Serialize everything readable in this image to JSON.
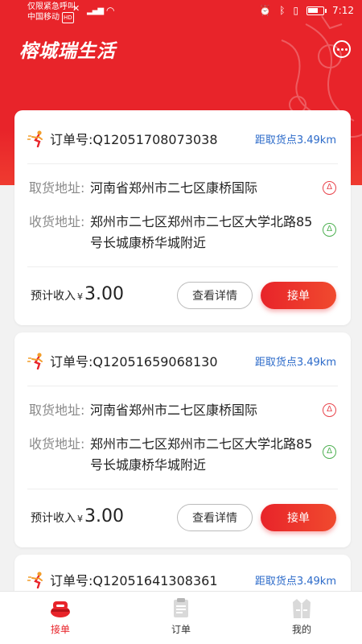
{
  "status_bar": {
    "carrier_line1": "仅限紧急呼叫",
    "carrier_line2": "中国移动",
    "hd_badge": "HD",
    "time": "7:12"
  },
  "header": {
    "brand": "榕城瑞生活",
    "chat_icon": "chat-bubble-icon"
  },
  "colors": {
    "brand_red": "#e8242a",
    "link_blue": "#2b6ac9",
    "pickup_badge": "#e8424a",
    "dropoff_badge": "#4caf50"
  },
  "orders": [
    {
      "order_label": "订单号:Q12051708073038",
      "distance": "距取货点3.49km",
      "pickup_label": "取货地址:",
      "pickup_address": "河南省郑州市二七区康桥国际",
      "dropoff_label": "收货地址:",
      "dropoff_address": "郑州市二七区郑州市二七区大学北路85号长城康桥华城附近",
      "pickup_badge": "Δ",
      "dropoff_badge": "Δ",
      "income_label": "预计收入",
      "currency": "¥",
      "income": "3.00",
      "detail_button": "查看详情",
      "accept_button": "接单"
    },
    {
      "order_label": "订单号:Q12051659068130",
      "distance": "距取货点3.49km",
      "pickup_label": "取货地址:",
      "pickup_address": "河南省郑州市二七区康桥国际",
      "dropoff_label": "收货地址:",
      "dropoff_address": "郑州市二七区郑州市二七区大学北路85号长城康桥华城附近",
      "pickup_badge": "Δ",
      "dropoff_badge": "Δ",
      "income_label": "预计收入",
      "currency": "¥",
      "income": "3.00",
      "detail_button": "查看详情",
      "accept_button": "接单"
    },
    {
      "order_label": "订单号:Q12051641308361",
      "distance": "距取货点3.49km"
    }
  ],
  "tabbar": {
    "tabs": [
      {
        "label": "接单",
        "icon": "accept-order-icon",
        "active": true
      },
      {
        "label": "订单",
        "icon": "order-list-icon",
        "active": false
      },
      {
        "label": "我的",
        "icon": "vest-profile-icon",
        "active": false
      }
    ]
  }
}
